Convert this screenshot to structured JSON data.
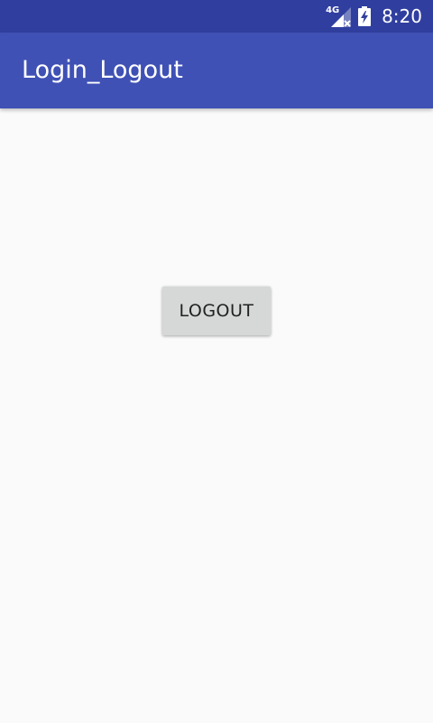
{
  "status_bar": {
    "network_type": "4G",
    "time": "8:20",
    "icons": [
      "signal-no-data-icon",
      "battery-charging-icon"
    ]
  },
  "app_bar": {
    "title": "Login_Logout"
  },
  "main": {
    "logout_label": "LOGOUT"
  },
  "colors": {
    "status_bar": "#303f9f",
    "primary": "#3f51b5",
    "background": "#fafafa",
    "button": "#d6d7d7"
  }
}
